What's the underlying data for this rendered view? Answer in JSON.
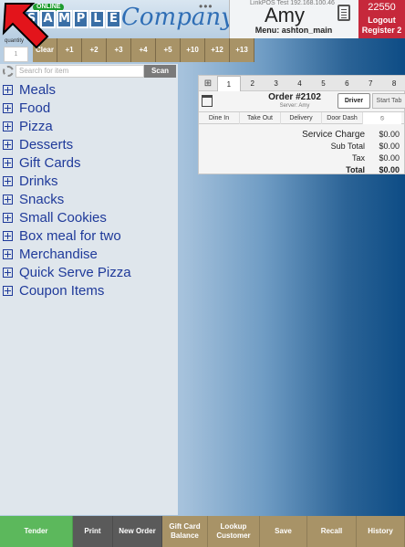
{
  "header": {
    "logo_letters": [
      "S",
      "A",
      "M",
      "P",
      "L",
      "E"
    ],
    "logo_company": "Company",
    "online_badge": "ONLINE",
    "dots": "•••",
    "device_info": "LinkPOS Test 192.168.100.46",
    "user_name": "Amy",
    "menu_line": "Menu: ashton_main",
    "register_number": "22550",
    "logout_label": "Logout",
    "register_label": "Register 2"
  },
  "quantity": {
    "label": "quantity",
    "value": "1",
    "clear_label": "Clear",
    "buttons": [
      "+1",
      "+2",
      "+3",
      "+4",
      "+5",
      "+10",
      "+12",
      "+13"
    ]
  },
  "search": {
    "placeholder": "Search for item",
    "scan_label": "Scan"
  },
  "categories": [
    "Meals",
    "Food",
    "Pizza",
    "Desserts",
    "Gift Cards",
    "Drinks",
    "Snacks",
    "Small Cookies",
    "Box meal for two",
    "Merchandise",
    "Quick Serve Pizza",
    "Coupon Items"
  ],
  "order": {
    "seat_tabs": [
      "1",
      "2",
      "3",
      "4",
      "5",
      "6",
      "7",
      "8"
    ],
    "title": "Order #2102",
    "server": "Server: Amy",
    "driver_label": "Driver",
    "start_tab_label": "Start Tab",
    "order_types": [
      "Dine In",
      "Take Out",
      "Delivery",
      "Door Dash"
    ],
    "no_symbol": "⦸",
    "totals": [
      {
        "label": "Service Charge",
        "value": "$0.00"
      },
      {
        "label": "Sub Total",
        "value": "$0.00"
      },
      {
        "label": "Tax",
        "value": "$0.00"
      },
      {
        "label": "Total",
        "value": "$0.00"
      }
    ]
  },
  "bottom_bar": [
    {
      "label": "Tender",
      "color": "#5cb85c"
    },
    {
      "label": "Print",
      "color": "#5a5a5a"
    },
    {
      "label": "New Order",
      "color": "#5a5a5a"
    },
    {
      "label": "Gift Card Balance",
      "color": "#a89367"
    },
    {
      "label": "Lookup Customer",
      "color": "#a89367"
    },
    {
      "label": "Save",
      "color": "#a89367"
    },
    {
      "label": "Recall",
      "color": "#a89367"
    },
    {
      "label": "History",
      "color": "#a89367"
    }
  ]
}
